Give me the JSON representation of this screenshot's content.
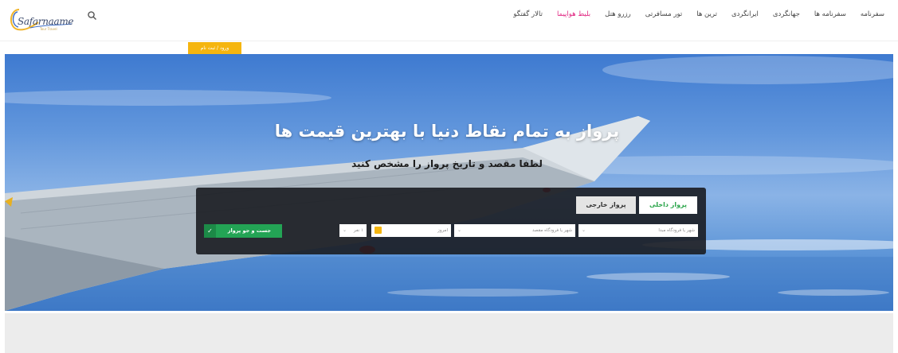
{
  "header": {
    "logo_text": "Safarnaame",
    "logo_tagline": "Tour Travel",
    "nav": [
      {
        "label": "سفرنامه",
        "active": false
      },
      {
        "label": "سفرنامه ها",
        "active": false
      },
      {
        "label": "جهانگردی",
        "active": false
      },
      {
        "label": "ایرانگردی",
        "active": false
      },
      {
        "label": "ترین ها",
        "active": false
      },
      {
        "label": "تور مسافرتی",
        "active": false
      },
      {
        "label": "رزرو هتل",
        "active": false
      },
      {
        "label": "بلیط هواپیما",
        "active": true
      },
      {
        "label": "تالار گفتگو",
        "active": false
      }
    ],
    "login_label": "ورود / ثبت نام"
  },
  "hero": {
    "title": "پرواز به تمام نقاط دنیا با بهترین قیمت ها",
    "subtitle": "لطفا مقصد و تاریخ پرواز را مشخص کنید"
  },
  "search": {
    "tabs": {
      "domestic": "پرواز داخلی",
      "international": "پرواز خارجی"
    },
    "origin_placeholder": "شهر یا فرودگاه مبدا",
    "destination_placeholder": "شهر یا فرودگاه مقصد",
    "date_value": "امروز",
    "passengers_value": "۱ نفر",
    "button_label": "جست و جو پرواز"
  },
  "colors": {
    "accent_pink": "#e02480",
    "accent_green": "#23a455",
    "accent_yellow": "#f5b50f"
  }
}
